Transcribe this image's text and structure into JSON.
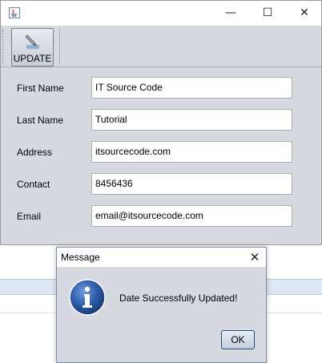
{
  "window": {
    "title": "",
    "controls": {
      "minimize": "—",
      "maximize": "☐",
      "close": "✕"
    }
  },
  "toolbar": {
    "update_label": "UPDATE",
    "update_icon": "edit-pen-icon"
  },
  "form": {
    "fields": [
      {
        "label": "First Name",
        "value": "IT Source Code"
      },
      {
        "label": "Last Name",
        "value": "Tutorial"
      },
      {
        "label": "Address",
        "value": "itsourcecode.com"
      },
      {
        "label": "Contact",
        "value": "8456436"
      },
      {
        "label": "Email",
        "value": "email@itsourcecode.com"
      }
    ]
  },
  "dialog": {
    "title": "Message",
    "close": "✕",
    "message": "Date Successfully Updated!",
    "ok_label": "OK",
    "icon": "info-icon"
  },
  "colors": {
    "panel_bg": "#d6d9df",
    "info_blue": "#2a5aa8",
    "ok_border": "#2a4c7e"
  }
}
